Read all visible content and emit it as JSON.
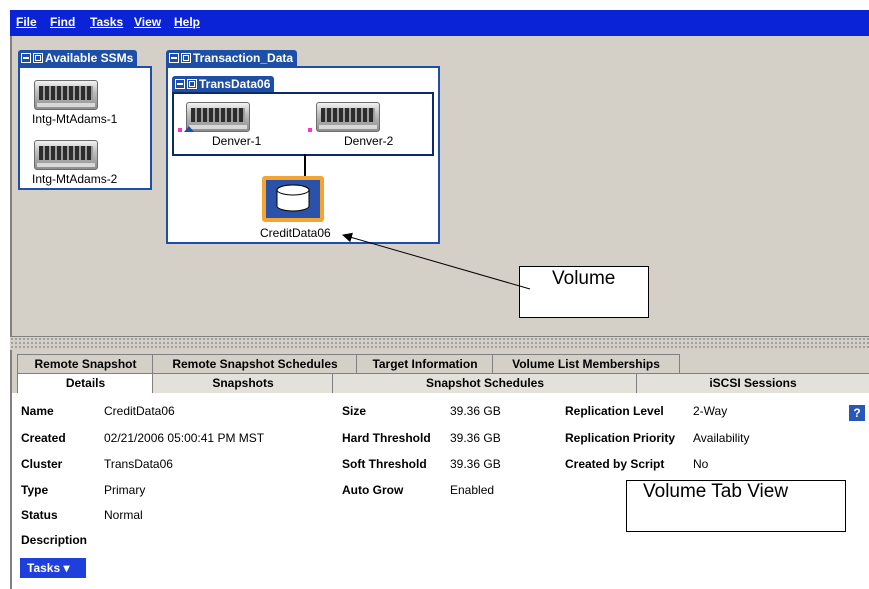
{
  "menu": [
    "File",
    "Find",
    "Tasks",
    "View",
    "Help"
  ],
  "top": {
    "available": {
      "title": "Available SSMs",
      "items": [
        "Intg-MtAdams-1",
        "Intg-MtAdams-2"
      ]
    },
    "management_group": {
      "title": "Transaction_Data",
      "cluster": {
        "title": "TransData06",
        "nodes": [
          "Denver-1",
          "Denver-2"
        ]
      },
      "volume": "CreditData06"
    }
  },
  "annotations": {
    "volume": "Volume",
    "tab_view": "Volume Tab View"
  },
  "tabs": {
    "back": [
      "Remote Snapshot",
      "Remote Snapshot Schedules",
      "Target Information",
      "Volume List Memberships"
    ],
    "front": [
      "Details",
      "Snapshots",
      "Snapshot Schedules",
      "iSCSI Sessions"
    ]
  },
  "details": {
    "col1": [
      {
        "label": "Name",
        "value": "CreditData06"
      },
      {
        "label": "Created",
        "value": "02/21/2006 05:00:41 PM MST"
      },
      {
        "label": "Cluster",
        "value": "TransData06"
      },
      {
        "label": "Type",
        "value": "Primary"
      },
      {
        "label": "Status",
        "value": "Normal"
      },
      {
        "label": "Description",
        "value": ""
      }
    ],
    "col2": [
      {
        "label": "Size",
        "value": "39.36 GB"
      },
      {
        "label": "Hard Threshold",
        "value": "39.36 GB"
      },
      {
        "label": "Soft Threshold",
        "value": "39.36 GB"
      },
      {
        "label": "Auto Grow",
        "value": "Enabled"
      }
    ],
    "col3": [
      {
        "label": "Replication Level",
        "value": "2-Way"
      },
      {
        "label": "Replication Priority",
        "value": "Availability"
      },
      {
        "label": "Created by Script",
        "value": "No"
      }
    ],
    "help": "?"
  },
  "tasks_button": "Tasks ▾"
}
